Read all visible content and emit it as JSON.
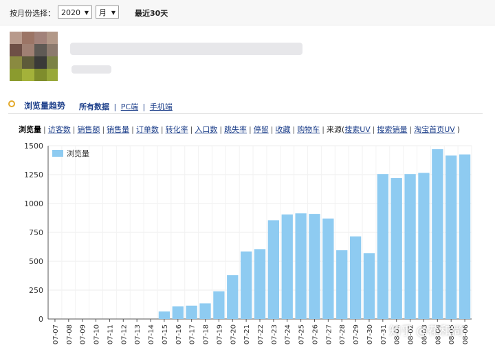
{
  "filter": {
    "label": "按月份选择：",
    "year": "2020",
    "month": "月",
    "recent": "最近30天"
  },
  "section": {
    "title": "浏览量趋势",
    "tabs": [
      "所有数据",
      "PC端",
      "手机端"
    ]
  },
  "metrics": {
    "items": [
      "浏览量",
      "访客数",
      "销售额",
      "销售量",
      "订单数",
      "转化率",
      "入口数",
      "跳失率",
      "停留",
      "收藏",
      "购物车"
    ],
    "source_label": "来源(",
    "sources": [
      "搜索UV",
      "搜索销量",
      "淘宝首页UV"
    ],
    "close": ")"
  },
  "colors": {
    "bar": "#8ecbf1",
    "accent": "#1d3f8a",
    "icon_ring": "#e3a92a"
  },
  "chart_data": {
    "type": "bar",
    "title": "",
    "xlabel": "",
    "ylabel": "",
    "ylim": [
      0,
      1500
    ],
    "yticks": [
      0,
      250,
      500,
      750,
      1000,
      1250,
      1500
    ],
    "grid": true,
    "legend_position": "top-left",
    "categories": [
      "07-07",
      "07-08",
      "07-09",
      "07-10",
      "07-11",
      "07-12",
      "07-13",
      "07-14",
      "07-15",
      "07-16",
      "07-17",
      "07-18",
      "07-19",
      "07-20",
      "07-21",
      "07-22",
      "07-23",
      "07-24",
      "07-25",
      "07-26",
      "07-27",
      "07-28",
      "07-29",
      "07-30",
      "07-31",
      "08-01",
      "08-02",
      "08-03",
      "08-04",
      "08-05",
      "08-06"
    ],
    "series": [
      {
        "name": "浏览量",
        "values": [
          0,
          0,
          0,
          0,
          0,
          0,
          0,
          0,
          65,
          110,
          115,
          135,
          240,
          380,
          585,
          605,
          855,
          905,
          915,
          910,
          870,
          595,
          715,
          570,
          1255,
          1220,
          1255,
          1265,
          1470,
          1415,
          1425
        ]
      }
    ]
  },
  "watermark": "知乎 @花和尚"
}
